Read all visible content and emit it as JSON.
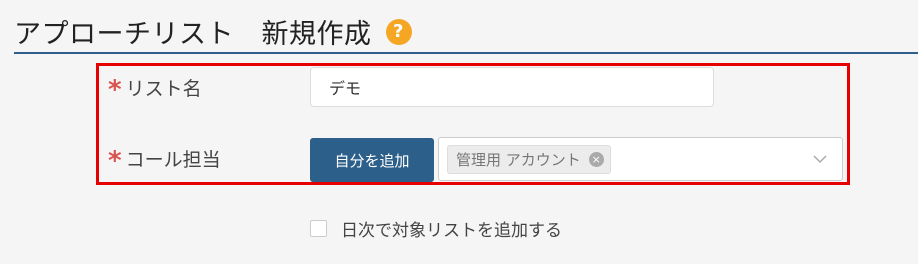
{
  "page": {
    "title": "アプローチリスト　新規作成",
    "help_icon": "question-circle-icon"
  },
  "form": {
    "list_name": {
      "required_mark": "*",
      "label": "リスト名",
      "value": "デモ"
    },
    "call_owner": {
      "required_mark": "*",
      "label": "コール担当",
      "add_self_label": "自分を追加",
      "selected_tags": [
        "管理用 アカウント"
      ],
      "tag_remove_glyph": "×"
    },
    "daily_add": {
      "label": "日次で対象リストを追加する",
      "checked": false
    }
  },
  "colors": {
    "accent": "#2c5f8a",
    "required": "#d9534f",
    "highlight": "#e60000",
    "help": "#f5a623"
  }
}
